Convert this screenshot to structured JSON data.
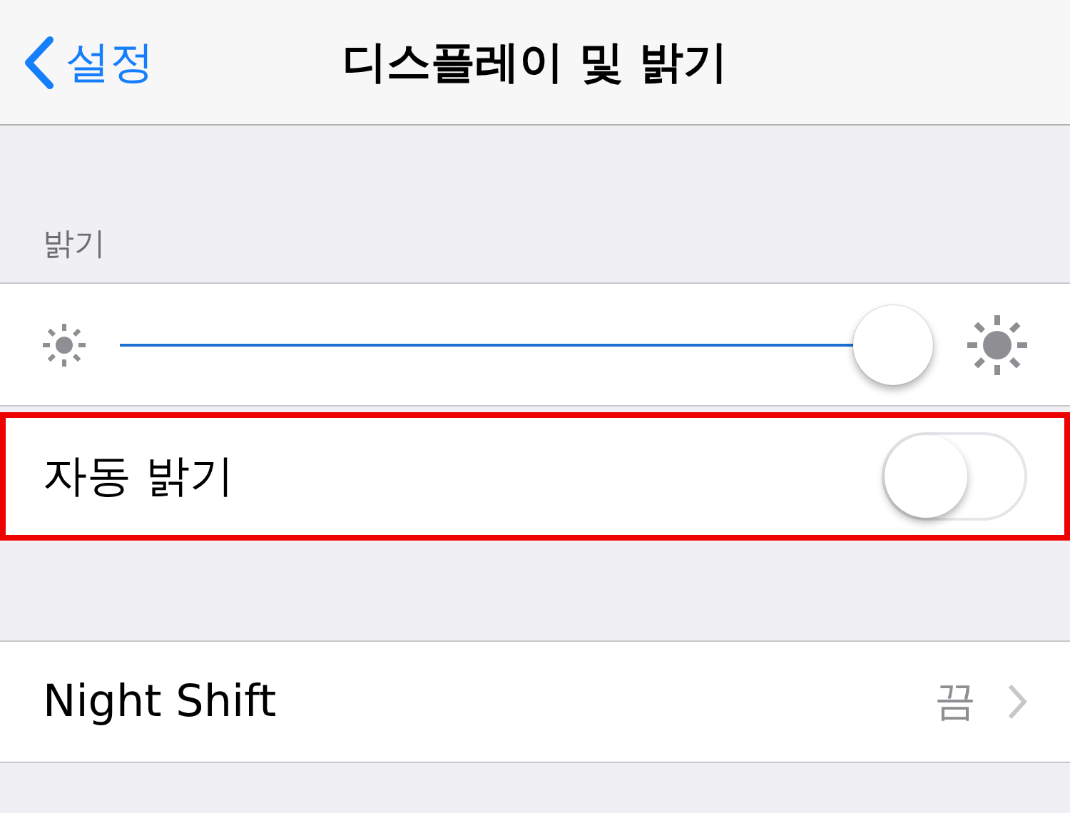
{
  "nav_bar": {
    "back_label": "설정",
    "title": "디스플레이 및 밝기"
  },
  "brightness_section": {
    "header": "밝기",
    "slider": {
      "level": 1.0
    }
  },
  "auto_brightness": {
    "label": "자동 밝기",
    "on": false,
    "highlighted": true
  },
  "night_shift": {
    "label": "Night Shift",
    "value": "끔"
  }
}
